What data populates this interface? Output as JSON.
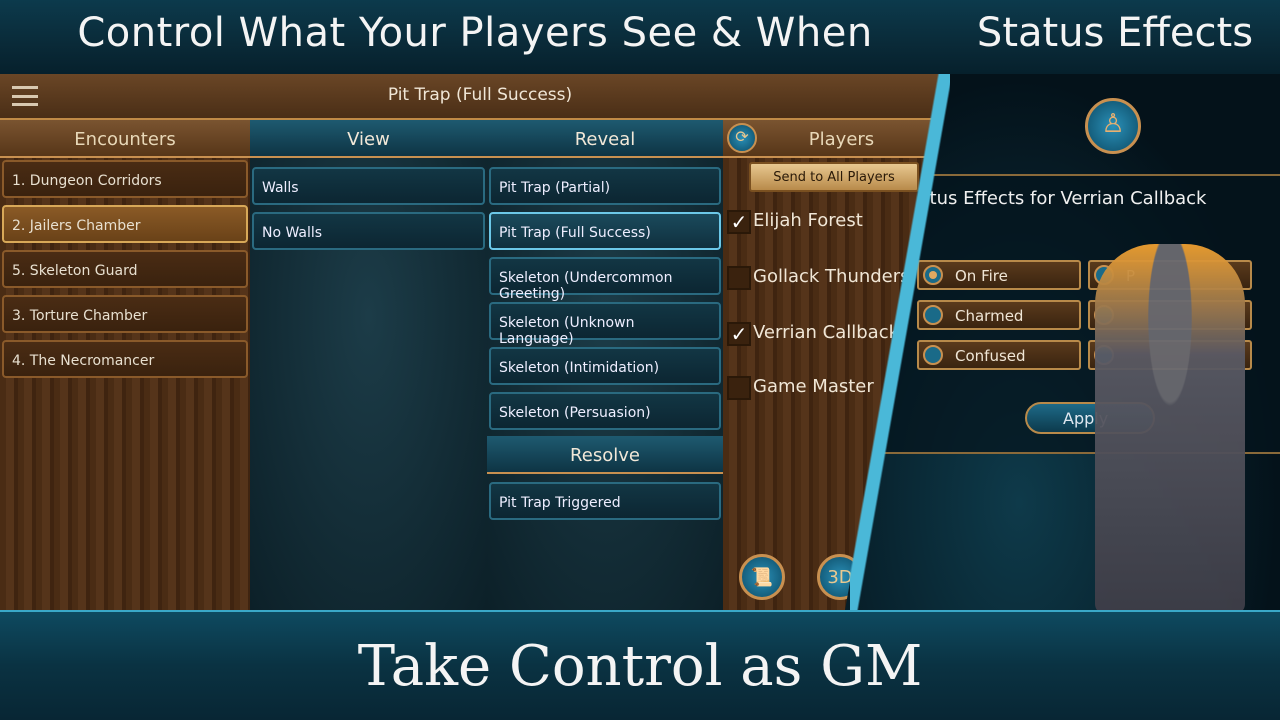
{
  "banners": {
    "top_left": "Control What Your Players See & When",
    "top_right": "Status Effects",
    "bottom": "Take Control as GM"
  },
  "app": {
    "header_title": "Pit Trap (Full Success)",
    "encounters": {
      "title": "Encounters",
      "items": [
        "1. Dungeon Corridors",
        "2. Jailers Chamber",
        "5. Skeleton Guard",
        "3. Torture Chamber",
        "4. The Necromancer"
      ],
      "selected": "2. Jailers Chamber"
    },
    "view": {
      "title": "View",
      "items": [
        "Walls",
        "No Walls"
      ]
    },
    "reveal": {
      "title": "Reveal",
      "items": [
        "Pit Trap (Partial)",
        "Pit Trap (Full Success)",
        "Skeleton (Undercommon Greeting)",
        "Skeleton (Unknown Language)",
        "Skeleton (Intimidation)",
        "Skeleton (Persuasion)"
      ],
      "selected": "Pit Trap (Full Success)"
    },
    "resolve": {
      "title": "Resolve",
      "items": [
        "Pit Trap Triggered"
      ]
    },
    "players": {
      "title": "Players",
      "send_all": "Send to All Players",
      "list": [
        {
          "name": "Elijah Forest",
          "checked": true
        },
        {
          "name": "Gollack Thunders",
          "checked": false
        },
        {
          "name": "Verrian Callback",
          "checked": true
        },
        {
          "name": "Game Master",
          "checked": false
        }
      ],
      "check_mark": "✓",
      "btn_3d": "3D"
    }
  },
  "status": {
    "title": "Status Effects for Verrian Callback",
    "options": [
      {
        "label": "On Fire",
        "selected": true
      },
      {
        "label": "Charmed",
        "selected": false
      },
      {
        "label": "Confused",
        "selected": false
      },
      {
        "label": "P",
        "selected": false
      },
      {
        "label": "",
        "selected": false
      },
      {
        "label": "",
        "selected": false
      }
    ],
    "apply": "Apply"
  },
  "colors": {
    "teal": "#0c3a4c",
    "wood": "#4a2c14",
    "gold": "#c89050",
    "highlight": "#4ab8d8"
  }
}
